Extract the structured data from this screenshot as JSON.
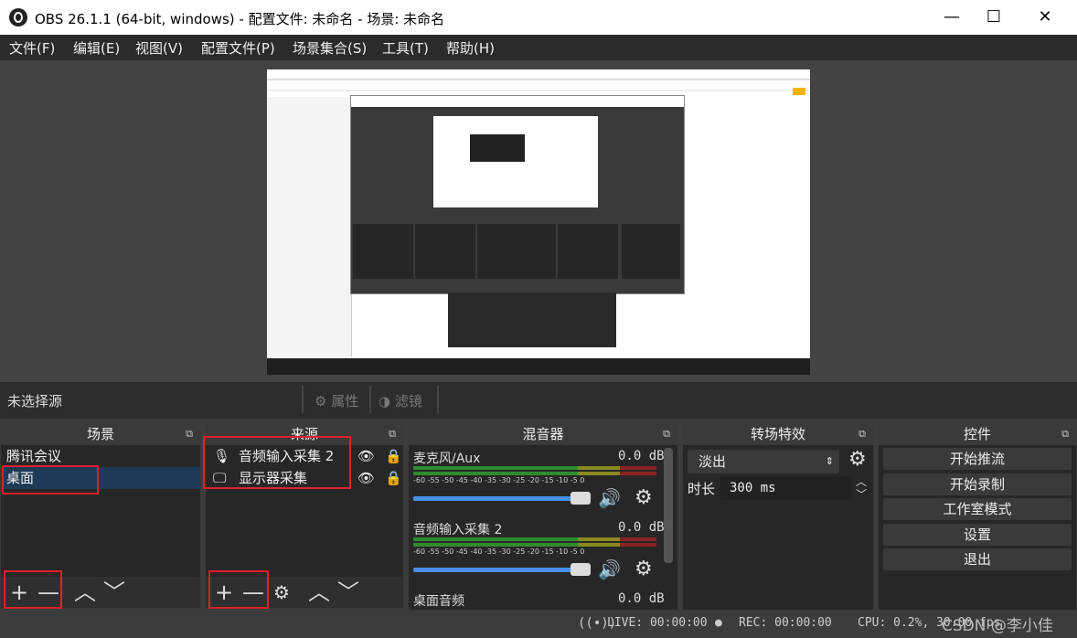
{
  "window": {
    "title": "OBS 26.1.1 (64-bit, windows) - 配置文件: 未命名 - 场景: 未命名",
    "min_icon": "minimize-icon",
    "max_icon": "maximize-icon",
    "close_icon": "close-icon",
    "min": "—",
    "max": "☐",
    "close": "✕"
  },
  "menu": [
    "文件(F)",
    "编辑(E)",
    "视图(V)",
    "配置文件(P)",
    "场景集合(S)",
    "工具(T)",
    "帮助(H)"
  ],
  "infobar": {
    "no_source": "未选择源",
    "properties": "属性",
    "filters": "滤镜"
  },
  "scenes": {
    "title": "场景",
    "items": [
      "腾讯会议",
      "桌面"
    ],
    "selected": "桌面"
  },
  "sources": {
    "title": "来源",
    "items": [
      "音频输入采集 2",
      "显示器采集"
    ]
  },
  "mixer": {
    "title": "混音器",
    "channels": [
      {
        "name": "麦克风/Aux",
        "db": "0.0 dB",
        "volume": 1.0
      },
      {
        "name": "音频输入采集 2",
        "db": "0.0 dB",
        "volume": 1.0
      },
      {
        "name": "桌面音频",
        "db": "0.0 dB"
      }
    ],
    "scale": "-60 -55 -50 -45 -40 -35 -30 -25 -20 -15 -10 -5 0"
  },
  "transitions": {
    "title": "转场特效",
    "selected": "淡出",
    "duration_label": "时长",
    "duration_value": "300 ms"
  },
  "controls": {
    "title": "控件",
    "buttons": [
      "开始推流",
      "开始录制",
      "工作室模式",
      "设置",
      "退出"
    ]
  },
  "status": {
    "live": "LIVE: 00:00:00",
    "rec": "REC: 00:00:00",
    "cpu": "CPU: 0.2%, 30.00 fps"
  },
  "watermark": "CSDN @李小佳",
  "colors": {
    "accent": "#4a8ef0",
    "highlight": "#e0202a",
    "selected": "#1f3a56"
  }
}
